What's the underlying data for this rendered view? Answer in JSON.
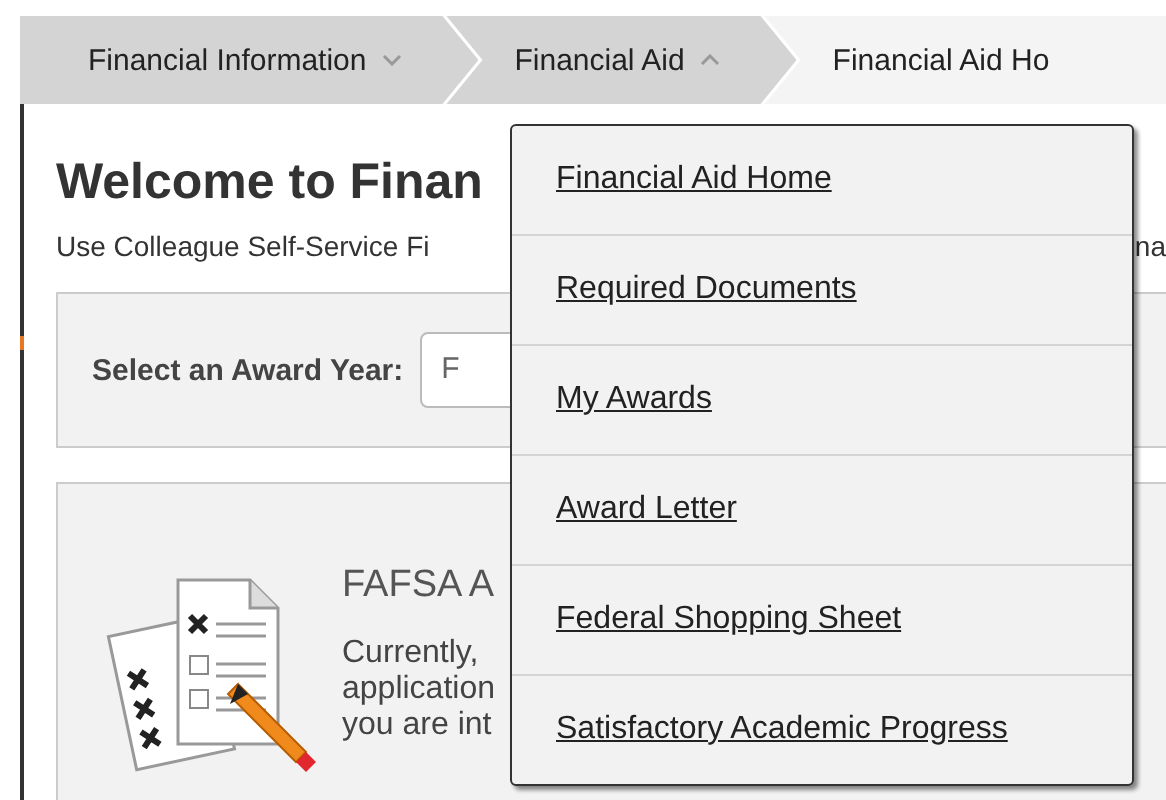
{
  "breadcrumbs": [
    {
      "label": "Financial Information",
      "kind": "menu",
      "expanded": false
    },
    {
      "label": "Financial Aid",
      "kind": "menu",
      "expanded": true
    },
    {
      "label": "Financial Aid Ho",
      "kind": "current"
    }
  ],
  "heading": "Welcome to Finan",
  "intro": {
    "text": "Use Colleague Self-Service Fi",
    "right_fragment": "na"
  },
  "award_year": {
    "label": "Select an Award Year:",
    "value": "F"
  },
  "fafsa_card": {
    "title": "FAFSA A",
    "lines": [
      "Currently,",
      "application",
      "you are int"
    ]
  },
  "dropdown": {
    "items": [
      {
        "label": "Financial Aid Home"
      },
      {
        "label": "Required Documents"
      },
      {
        "label": "My Awards"
      },
      {
        "label": "Award Letter"
      },
      {
        "label": "Federal Shopping Sheet"
      },
      {
        "label": "Satisfactory Academic Progress"
      }
    ]
  }
}
